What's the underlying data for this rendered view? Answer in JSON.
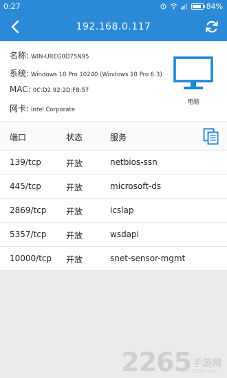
{
  "status_bar": {
    "time": "0:27",
    "battery": "84%",
    "battery_level": 0.84
  },
  "app_bar": {
    "title": "192.168.0.117",
    "back_icon": "chevron-left-icon",
    "refresh_icon": "refresh-icon"
  },
  "device_info": {
    "name_label": "名称:",
    "name_value": "WIN-UREG0D75N95",
    "os_label": "系统:",
    "os_value": "Windows 10 Pro 10240 (Windows 10 Pro 6.3)",
    "mac_label": "MAC:",
    "mac_value": "0C:D2:92:2D:F8:57",
    "nic_label": "网卡:",
    "nic_value": "Intel Corporate",
    "device_type_label": "电脑",
    "device_icon": "computer-monitor-icon"
  },
  "ports_table": {
    "headers": [
      "端口",
      "状态",
      "服务"
    ],
    "copy_icon": "copy-icon",
    "rows": [
      {
        "port": "139/tcp",
        "status": "开放",
        "service": "netbios-ssn"
      },
      {
        "port": "445/tcp",
        "status": "开放",
        "service": "microsoft-ds"
      },
      {
        "port": "2869/tcp",
        "status": "开放",
        "service": "icslap"
      },
      {
        "port": "5357/tcp",
        "status": "开放",
        "service": "wsdapi"
      },
      {
        "port": "10000/tcp",
        "status": "开放",
        "service": "snet-sensor-mgmt"
      }
    ]
  },
  "watermark": {
    "number": "2265",
    "cn": "手游网",
    "url": "2265.com"
  },
  "colors": {
    "accent": "#2a8ad8",
    "monitor": "#1a86d6",
    "background": "#ebebeb"
  }
}
